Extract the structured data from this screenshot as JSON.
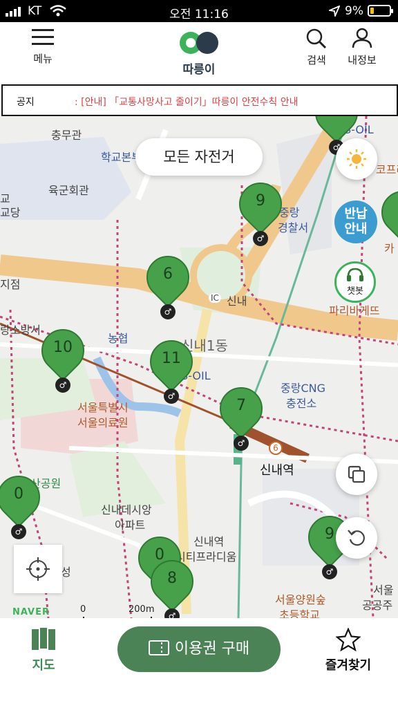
{
  "status_bar": {
    "carrier": "KT",
    "time": "오전 11:16",
    "battery": "9%"
  },
  "header": {
    "menu_label": "메뉴",
    "logo_text": "따릉이",
    "search_label": "검색",
    "profile_label": "내정보"
  },
  "notice": {
    "label": "공지",
    "text": ": [안내] 「교통사망사고 줄이기」따릉이 안전수칙 안내"
  },
  "map": {
    "filter_label": "모든 자전거",
    "return_guide_label": "반납\n안내",
    "chatbot_label": "챗봇",
    "naver_label": "NAVER",
    "scale_start": "0",
    "scale_end": "200m",
    "places": [
      "충무관",
      "학교본부",
      "육군회관",
      "교",
      "교당",
      "지점",
      "랑소방서",
      "S-OIL",
      "중랑",
      "경찰서",
      "코프라",
      "카",
      "파리바게뜨",
      "IC",
      "신내",
      "농협",
      "신내1동",
      "S-OIL",
      "중랑CNG",
      "충전소",
      "서울특별시",
      "서울의료원",
      "6",
      "신내역",
      "산공원",
      "신내데시앙",
      "아파트",
      "신내역",
      "시티프라디움",
      "성",
      "서울양원숲",
      "초등학교",
      "서울",
      "공공주"
    ],
    "markers": [
      "9",
      "6",
      "10",
      "11",
      "7",
      "0",
      "0",
      "8",
      "9"
    ]
  },
  "bottom_nav": {
    "map_label": "지도",
    "buy_label": "이용권 구매",
    "favorites_label": "즐겨찾기"
  },
  "colors": {
    "brand_green": "#4b8256",
    "marker_green": "#47a04a",
    "notice_red": "#e14040",
    "return_blue": "#3a9ccf"
  }
}
